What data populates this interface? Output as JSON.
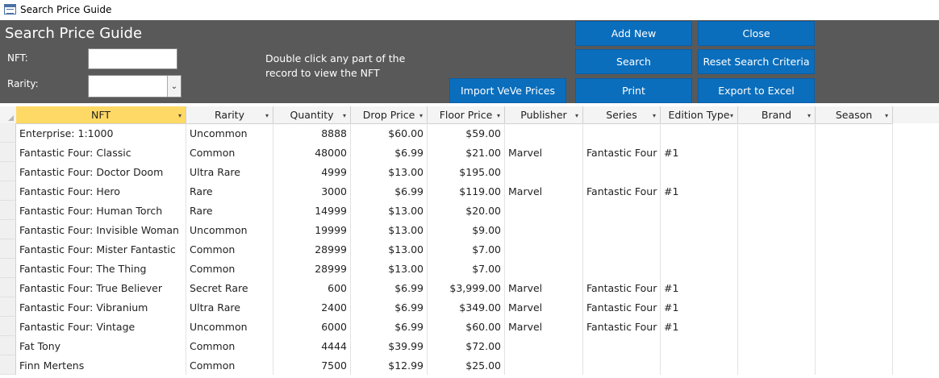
{
  "window": {
    "title": "Search Price Guide"
  },
  "form": {
    "title": "Search Price Guide",
    "nft_label": "NFT:",
    "rarity_label": "Rarity:",
    "nft_value": "",
    "rarity_value": "",
    "hint": "Double click any part of the record to view the NFT"
  },
  "buttons": {
    "add_new": "Add New",
    "close": "Close",
    "search": "Search",
    "reset": "Reset Search Criteria",
    "import": "Import VeVe Prices",
    "print": "Print",
    "export": "Export to Excel"
  },
  "colors": {
    "header_bg": "#595959",
    "button_bg": "#0a6ebd",
    "active_col": "#ffd966"
  },
  "columns": [
    "NFT",
    "Rarity",
    "Quantity",
    "Drop Price",
    "Floor Price",
    "Publisher",
    "Series",
    "Edition Type",
    "Brand",
    "Season"
  ],
  "rows": [
    [
      "Enterprise: 1:1000",
      "Uncommon",
      "8888",
      "$60.00",
      "$59.00",
      "",
      "",
      "",
      "",
      ""
    ],
    [
      "Fantastic Four: Classic",
      "Common",
      "48000",
      "$6.99",
      "$21.00",
      "Marvel",
      "Fantastic Four",
      "#1",
      "",
      ""
    ],
    [
      "Fantastic Four: Doctor Doom",
      "Ultra Rare",
      "4999",
      "$13.00",
      "$195.00",
      "",
      "",
      "",
      "",
      ""
    ],
    [
      "Fantastic Four: Hero",
      "Rare",
      "3000",
      "$6.99",
      "$119.00",
      "Marvel",
      "Fantastic Four",
      "#1",
      "",
      ""
    ],
    [
      "Fantastic Four: Human Torch",
      "Rare",
      "14999",
      "$13.00",
      "$20.00",
      "",
      "",
      "",
      "",
      ""
    ],
    [
      "Fantastic Four: Invisible Woman",
      "Uncommon",
      "19999",
      "$13.00",
      "$9.00",
      "",
      "",
      "",
      "",
      ""
    ],
    [
      "Fantastic Four: Mister Fantastic",
      "Common",
      "28999",
      "$13.00",
      "$7.00",
      "",
      "",
      "",
      "",
      ""
    ],
    [
      "Fantastic Four: The Thing",
      "Common",
      "28999",
      "$13.00",
      "$7.00",
      "",
      "",
      "",
      "",
      ""
    ],
    [
      "Fantastic Four: True Believer",
      "Secret Rare",
      "600",
      "$6.99",
      "$3,999.00",
      "Marvel",
      "Fantastic Four",
      "#1",
      "",
      ""
    ],
    [
      "Fantastic Four: Vibranium",
      "Ultra Rare",
      "2400",
      "$6.99",
      "$349.00",
      "Marvel",
      "Fantastic Four",
      "#1",
      "",
      ""
    ],
    [
      "Fantastic Four: Vintage",
      "Uncommon",
      "6000",
      "$6.99",
      "$60.00",
      "Marvel",
      "Fantastic Four",
      "#1",
      "",
      ""
    ],
    [
      "Fat Tony",
      "Common",
      "4444",
      "$39.99",
      "$72.00",
      "",
      "",
      "",
      "",
      ""
    ],
    [
      "Finn Mertens",
      "Common",
      "7500",
      "$12.99",
      "$25.00",
      "",
      "",
      "",
      "",
      ""
    ]
  ]
}
